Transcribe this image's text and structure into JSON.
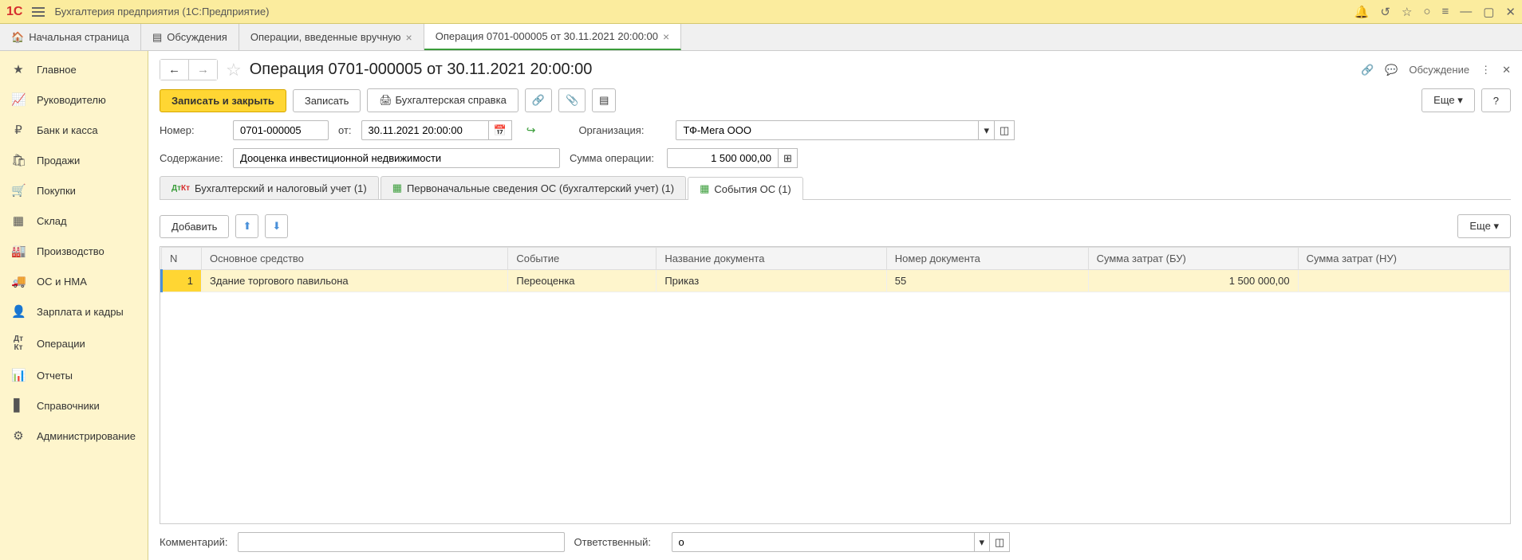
{
  "titlebar": {
    "title": "Бухгалтерия предприятия  (1С:Предприятие)"
  },
  "tabs": [
    {
      "label": "Начальная страница"
    },
    {
      "label": "Обсуждения"
    },
    {
      "label": "Операции, введенные вручную"
    },
    {
      "label": "Операция 0701-000005 от 30.11.2021 20:00:00",
      "active": true
    }
  ],
  "sidebar": {
    "items": [
      {
        "label": "Главное"
      },
      {
        "label": "Руководителю"
      },
      {
        "label": "Банк и касса"
      },
      {
        "label": "Продажи"
      },
      {
        "label": "Покупки"
      },
      {
        "label": "Склад"
      },
      {
        "label": "Производство"
      },
      {
        "label": "ОС и НМА"
      },
      {
        "label": "Зарплата и кадры"
      },
      {
        "label": "Операции"
      },
      {
        "label": "Отчеты"
      },
      {
        "label": "Справочники"
      },
      {
        "label": "Администрирование"
      }
    ]
  },
  "page": {
    "title": "Операция 0701-000005 от 30.11.2021 20:00:00",
    "discuss": "Обсуждение"
  },
  "toolbar": {
    "save_close": "Записать и закрыть",
    "save": "Записать",
    "print": "Бухгалтерская справка",
    "more": "Еще"
  },
  "form": {
    "number_label": "Номер:",
    "number": "0701-000005",
    "date_label": "от:",
    "date": "30.11.2021 20:00:00",
    "org_label": "Организация:",
    "org": "ТФ-Мега ООО",
    "content_label": "Содержание:",
    "content": "Дооценка инвестиционной недвижимости",
    "sum_label": "Сумма операции:",
    "sum": "1 500 000,00"
  },
  "inner_tabs": [
    {
      "label": "Бухгалтерский и налоговый учет (1)"
    },
    {
      "label": "Первоначальные сведения ОС (бухгалтерский учет) (1)"
    },
    {
      "label": "События ОС (1)",
      "active": true
    }
  ],
  "table_toolbar": {
    "add": "Добавить",
    "more": "Еще"
  },
  "table": {
    "columns": [
      "N",
      "Основное средство",
      "Событие",
      "Название документа",
      "Номер документа",
      "Сумма затрат (БУ)",
      "Сумма затрат (НУ)"
    ],
    "rows": [
      {
        "n": "1",
        "asset": "Здание торгового павильона",
        "event": "Переоценка",
        "doc_name": "Приказ",
        "doc_num": "55",
        "sum_bu": "1 500 000,00",
        "sum_nu": ""
      }
    ]
  },
  "bottom": {
    "comment_label": "Комментарий:",
    "comment": "",
    "resp_label": "Ответственный:",
    "resp": "о"
  },
  "misc": {
    "question": "?"
  }
}
